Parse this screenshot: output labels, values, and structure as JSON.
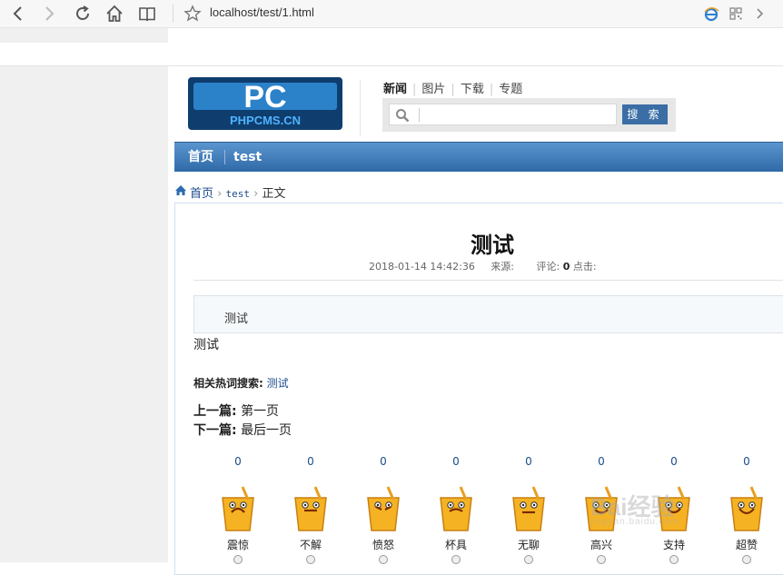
{
  "browser": {
    "url": "localhost/test/1.html"
  },
  "header": {
    "logo_text": "PHPCMS.CN",
    "categories": [
      {
        "label": "新闻",
        "active": true
      },
      {
        "label": "图片",
        "active": false
      },
      {
        "label": "下载",
        "active": false
      },
      {
        "label": "专题",
        "active": false
      }
    ],
    "search": {
      "placeholder": "",
      "button_label": "搜 索"
    }
  },
  "nav": {
    "items": [
      "首页",
      "test"
    ]
  },
  "breadcrumb": {
    "home": "首页",
    "category": "test",
    "current": "正文"
  },
  "article": {
    "title": "测试",
    "date": "2018-01-14 14:42:36",
    "source_label": "来源:",
    "comment_label": "评论:",
    "comment_count": "0",
    "hits_label": "点击:",
    "summary": "测试",
    "body": "测试",
    "hot_label": "相关热词搜索:",
    "hot_word": "测试",
    "prev_label": "上一篇:",
    "prev_title": "第一页",
    "next_label": "下一篇:",
    "next_title": "最后一页"
  },
  "moods": [
    {
      "label": "震惊",
      "count": "0"
    },
    {
      "label": "不解",
      "count": "0"
    },
    {
      "label": "愤怒",
      "count": "0"
    },
    {
      "label": "杯具",
      "count": "0"
    },
    {
      "label": "无聊",
      "count": "0"
    },
    {
      "label": "高兴",
      "count": "0"
    },
    {
      "label": "支持",
      "count": "0"
    },
    {
      "label": "超赞",
      "count": "0"
    }
  ],
  "watermark": {
    "text": "Bai经验",
    "sub": "jingyan.baidu.com"
  },
  "colors": {
    "nav_blue": "#3a72b0",
    "link_blue": "#1a4b8b",
    "emoji_yellow": "#f5b324"
  }
}
